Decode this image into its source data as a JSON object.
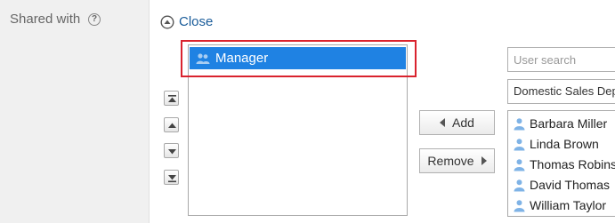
{
  "field": {
    "label": "Shared with",
    "help_icon": "question-circle-icon",
    "help_glyph": "?"
  },
  "close": {
    "label": "Close",
    "icon": "collapse-up-circle-icon"
  },
  "order_buttons": [
    {
      "name": "move-to-top-icon"
    },
    {
      "name": "move-up-icon"
    },
    {
      "name": "move-down-icon"
    },
    {
      "name": "move-to-bottom-icon"
    }
  ],
  "selected_list": {
    "items": [
      {
        "label": "Manager",
        "icon": "group-icon",
        "selected": true
      }
    ]
  },
  "buttons": {
    "add": "Add",
    "remove": "Remove"
  },
  "search": {
    "placeholder": "User search",
    "value": ""
  },
  "department": {
    "selected": "Domestic Sales Dept"
  },
  "users": [
    {
      "name": "Barbara Miller"
    },
    {
      "name": "Linda Brown"
    },
    {
      "name": "Thomas Robinson"
    },
    {
      "name": "David Thomas"
    },
    {
      "name": "William Taylor"
    }
  ],
  "colors": {
    "accent": "#1f82e3",
    "link": "#1a5c9a",
    "highlight": "#d9232e",
    "label_bg": "#f0f0f0",
    "user_icon": "#7fb3e6"
  }
}
